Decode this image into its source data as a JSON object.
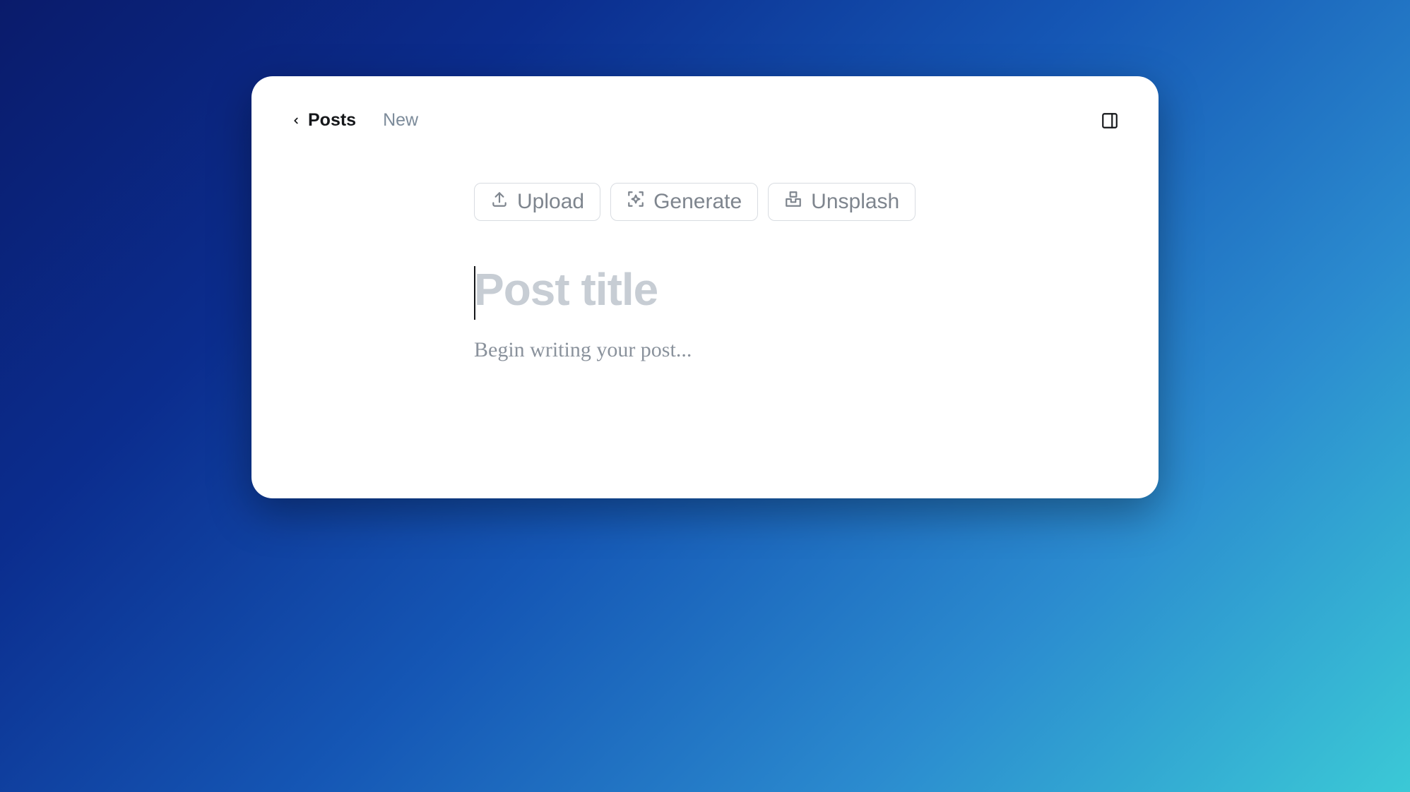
{
  "breadcrumb": {
    "back_label": "Posts",
    "current_label": "New"
  },
  "image_actions": {
    "upload_label": "Upload",
    "generate_label": "Generate",
    "unsplash_label": "Unsplash"
  },
  "editor": {
    "title_value": "",
    "title_placeholder": "Post title",
    "body_value": "",
    "body_placeholder": "Begin writing your post..."
  }
}
